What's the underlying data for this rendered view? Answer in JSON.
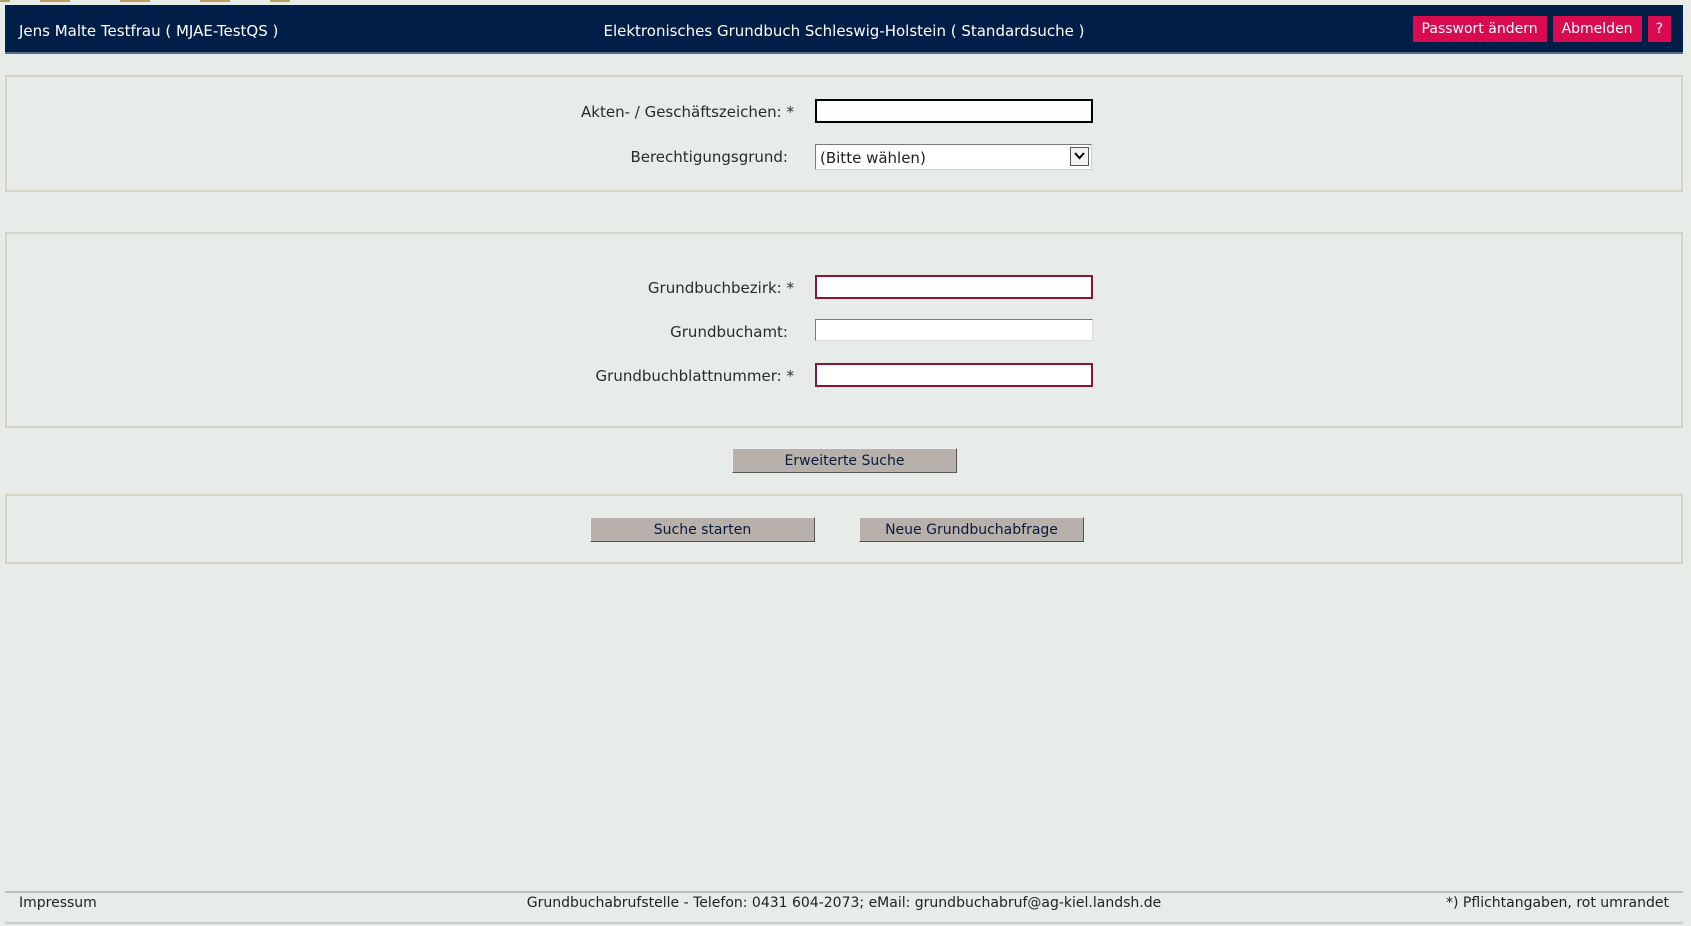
{
  "header": {
    "user": "Jens Malte Testfrau  ( MJAE-TestQS )",
    "title": "Elektronisches Grundbuch Schleswig-Holstein  ( Standardsuche )",
    "buttons": {
      "change_password": "Passwort ändern",
      "logout": "Abmelden",
      "help": "?"
    }
  },
  "panel1": {
    "akten_label": "Akten- / Geschäftszeichen: *",
    "akten_value": "",
    "grund_label": "Berechtigungsgrund:",
    "grund_selected": "(Bitte wählen)"
  },
  "panel2": {
    "bezirk_label": "Grundbuchbezirk: *",
    "bezirk_value": "",
    "amt_label": "Grundbuchamt:",
    "amt_value": "",
    "blatt_label": "Grundbuchblattnummer: *",
    "blatt_value": ""
  },
  "actions": {
    "extended_search": "Erweiterte Suche",
    "start_search": "Suche starten",
    "new_query": "Neue Grundbuchabfrage"
  },
  "footer": {
    "impressum": "Impressum",
    "contact": "Grundbuchabrufstelle - Telefon: 0431 604-2073; eMail: grundbuchabruf@ag-kiel.landsh.de",
    "note": "*) Pflichtangaben, rot umrandet"
  },
  "colors": {
    "header_bg": "#001e48",
    "accent_button": "#d90a50",
    "required_border": "#8a1538",
    "page_bg": "#e8ece9",
    "gray_button": "#b8b0aa"
  }
}
